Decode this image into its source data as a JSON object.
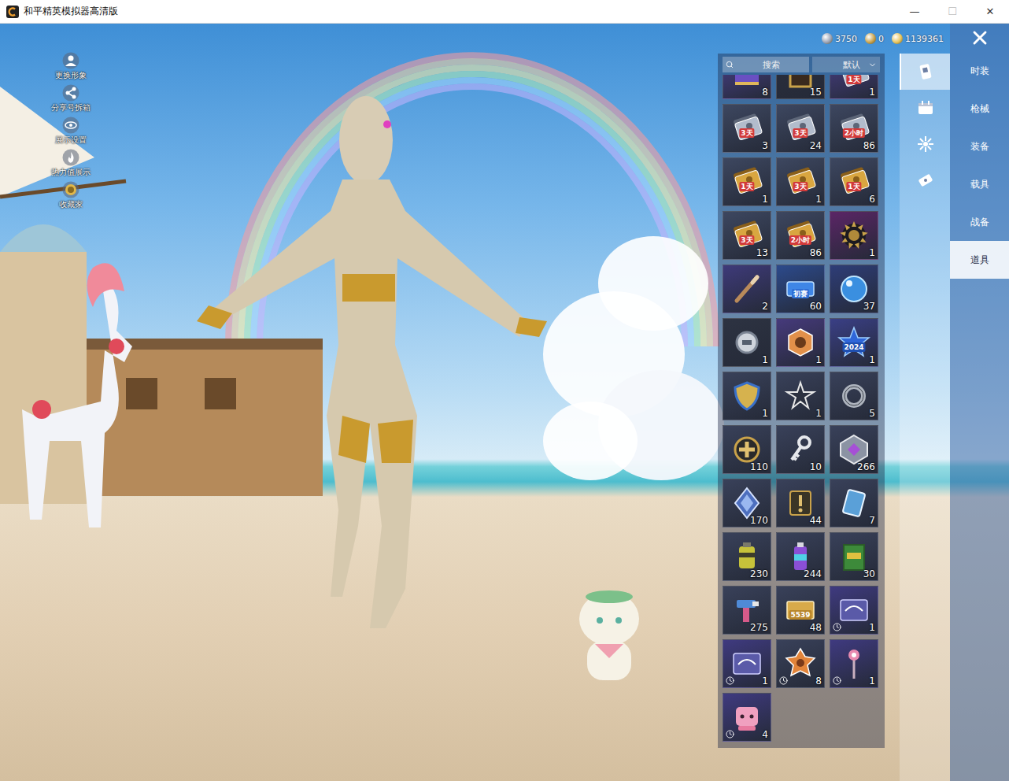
{
  "window": {
    "title": "和平精英模拟器高清版",
    "controls": [
      {
        "label": "—",
        "disabled": false
      },
      {
        "label": "☐",
        "disabled": true
      },
      {
        "label": "✕",
        "disabled": false
      }
    ]
  },
  "side_menu": [
    {
      "label": "更换形象",
      "kind": "avatar"
    },
    {
      "label": "分享号拆箱",
      "kind": "share"
    },
    {
      "label": "展示设置",
      "kind": "eye"
    },
    {
      "label": "热力值展示",
      "kind": "fire"
    },
    {
      "label": "收藏家",
      "kind": "collector"
    }
  ],
  "currencies": [
    {
      "amount": "3750",
      "color": "#9aa3b5"
    },
    {
      "amount": "0",
      "color": "#c9a24a"
    },
    {
      "amount": "1139361",
      "color": "#e8c45a"
    }
  ],
  "search": {
    "placeholder": "搜索"
  },
  "sort": {
    "value": "默认"
  },
  "category_tabs": [
    {
      "kind": "card",
      "selected": true
    },
    {
      "kind": "calendar",
      "selected": false
    },
    {
      "kind": "burst",
      "selected": false
    },
    {
      "kind": "ticket",
      "selected": false
    }
  ],
  "nav": [
    {
      "label": "时装",
      "selected": false
    },
    {
      "label": "枪械",
      "selected": false
    },
    {
      "label": "装备",
      "selected": false
    },
    {
      "label": "载具",
      "selected": false
    },
    {
      "label": "战备",
      "selected": false
    },
    {
      "label": "道具",
      "selected": true
    }
  ],
  "items": [
    {
      "count": "8",
      "kind": "book",
      "color": "#4b3f8f",
      "timed": false
    },
    {
      "count": "15",
      "kind": "frame",
      "color": "#2b2f3d",
      "timed": false
    },
    {
      "count": "1",
      "kind": "silvercard",
      "color": "#4a3f8a",
      "tag": "1天",
      "tagColor": "#d23a3a",
      "timed": false
    },
    {
      "count": "3",
      "kind": "silvercard",
      "color": "#3d4760",
      "tag": "3天",
      "tagColor": "#d23a3a",
      "timed": false
    },
    {
      "count": "24",
      "kind": "silvercard",
      "color": "#3d4760",
      "tag": "3天",
      "tagColor": "#d23a3a",
      "timed": false
    },
    {
      "count": "86",
      "kind": "silvercard",
      "color": "#3d4760",
      "tag": "2小时",
      "tagColor": "#d23a3a",
      "timed": false
    },
    {
      "count": "1",
      "kind": "goldcard",
      "color": "#3d4760",
      "tag": "1天",
      "tagColor": "#d23a3a",
      "timed": false
    },
    {
      "count": "1",
      "kind": "goldcard",
      "color": "#3d4760",
      "tag": "3天",
      "tagColor": "#d23a3a",
      "timed": false
    },
    {
      "count": "6",
      "kind": "goldcard",
      "color": "#3d4760",
      "tag": "1天",
      "tagColor": "#d23a3a",
      "timed": false
    },
    {
      "count": "13",
      "kind": "goldcard",
      "color": "#3d4760",
      "tag": "3天",
      "tagColor": "#d23a3a",
      "timed": false
    },
    {
      "count": "86",
      "kind": "goldcard",
      "color": "#3d4760",
      "tag": "2小时",
      "tagColor": "#d23a3a",
      "timed": false
    },
    {
      "count": "1",
      "kind": "emblem",
      "color": "#5b2566",
      "timed": false
    },
    {
      "count": "2",
      "kind": "stick",
      "color": "#3e3a7a",
      "timed": false
    },
    {
      "count": "60",
      "kind": "ticket",
      "color": "#2c4a8c",
      "tag": "初赛",
      "tagColor": "#2f6fd6",
      "timed": false
    },
    {
      "count": "37",
      "kind": "orb",
      "color": "#2e3d78",
      "timed": false
    },
    {
      "count": "1",
      "kind": "coin",
      "color": "#2d3342",
      "timed": false
    },
    {
      "count": "1",
      "kind": "medal",
      "color": "#463a7c",
      "timed": false
    },
    {
      "count": "1",
      "kind": "star",
      "color": "#3a3f86",
      "tag": "2024",
      "tagColor": "#1f4fb0",
      "timed": false
    },
    {
      "count": "1",
      "kind": "shield",
      "color": "#39415a",
      "timed": false
    },
    {
      "count": "1",
      "kind": "starbadge",
      "color": "#39415a",
      "timed": false
    },
    {
      "count": "5",
      "kind": "ring",
      "color": "#39415a",
      "timed": false
    },
    {
      "count": "110",
      "kind": "cross",
      "color": "#39415a",
      "timed": false
    },
    {
      "count": "10",
      "kind": "key",
      "color": "#39415a",
      "timed": false
    },
    {
      "count": "266",
      "kind": "gem",
      "color": "#39415a",
      "timed": false
    },
    {
      "count": "170",
      "kind": "diamond",
      "color": "#39415a",
      "timed": false
    },
    {
      "count": "44",
      "kind": "alert",
      "color": "#39415a",
      "timed": false
    },
    {
      "count": "7",
      "kind": "cardpack",
      "color": "#39415a",
      "timed": false
    },
    {
      "count": "230",
      "kind": "canister",
      "color": "#39415a",
      "timed": false
    },
    {
      "count": "244",
      "kind": "spray",
      "color": "#39415a",
      "timed": false
    },
    {
      "count": "30",
      "kind": "crate",
      "color": "#39415a",
      "timed": false
    },
    {
      "count": "275",
      "kind": "spraygun",
      "color": "#39415a",
      "timed": false
    },
    {
      "count": "48",
      "kind": "voucher",
      "color": "#39415a",
      "tag": "5539",
      "tagColor": "#b8862b",
      "timed": false
    },
    {
      "count": "1",
      "kind": "chip",
      "color": "#3f3a80",
      "timed": true
    },
    {
      "count": "1",
      "kind": "chip",
      "color": "#3f3a80",
      "timed": true
    },
    {
      "count": "8",
      "kind": "crest",
      "color": "#39415a",
      "timed": true
    },
    {
      "count": "1",
      "kind": "wand",
      "color": "#3f3a80",
      "timed": true
    },
    {
      "count": "4",
      "kind": "doll",
      "color": "#3f3a80",
      "timed": true
    }
  ]
}
